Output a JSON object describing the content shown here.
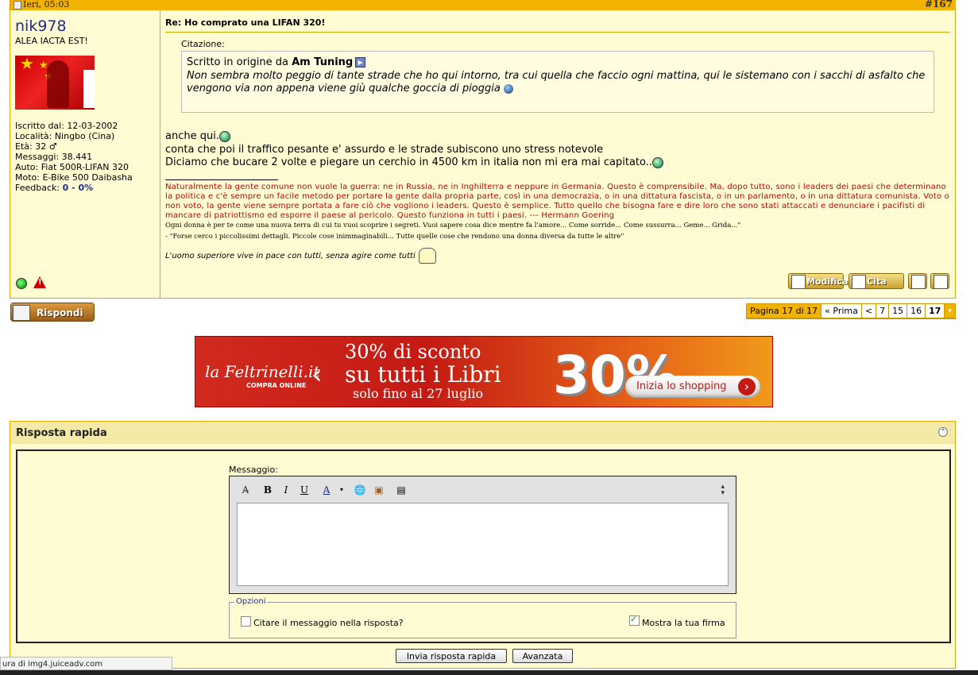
{
  "post": {
    "date": "Ieri, 05:03",
    "number": "#167",
    "title": "Re: Ho comprato una LIFAN 320!",
    "quote_label": "Citazione:",
    "quote_prefix": "Scritto in origine da",
    "quote_author": "Am Tuning",
    "quote_text": "Non sembra molto peggio di tante strade che ho qui intorno, tra cui quella che faccio ogni mattina, qui le sistemano con i sacchi di asfalto che vengono via non appena viene giù qualche goccia di pioggia",
    "body_line1": "anche qui.",
    "body_line2": "conta che poi il traffico pesante e' assurdo e le strade subiscono uno stress notevole",
    "body_line3": "Diciamo che bucare 2 volte e piegare un cerchio in 4500 km in italia non mi era mai capitato..",
    "sig1": "Naturalmente la gente comune non vuole la guerra: ne in Russia, ne in Inghilterra e neppure in Germania. Questo è comprensibile. Ma, dopo tutto, sono i leaders dei paesi che determinano la politica e c'è sempre un facile metodo per portare la gente dalla propria parte, così in una democrazia, o in una dittatura fascista, o in un parlamento, o in una dittatura comunista. Voto o non voto, la gente viene sempre portata a fare ciò che vogliono i leaders. Questo è semplice. Tutto quello che bisogna fare e dire loro che sono stati attaccati e denunciare i pacifisti di mancare di patriottismo ed esporre il paese al pericolo. Questo funziona in tutti i paesi. --- Hermann Goering",
    "sig2": "Ogni donna è per te come una nuova terra di cui tu vuoi scoprire i segreti. Vuoi sapere cosa dice mentre fa l'amore... Come sorride... Come sussurra... Geme... Grida...\"",
    "sig3": "- \"Forse cerco i piccolissimi dettagli. Piccole cose inimmaginabili... Tutte quelle cose che rendono una donna diversa da tutte le altre\"",
    "sig4": "L'uomo superiore vive in pace con tutti, senza agire come tutti",
    "btn_edit": "Modifica",
    "btn_quote": "Cita"
  },
  "user": {
    "name": "nik978",
    "title": "ALEA IACTA EST!",
    "joined": "Iscritto dal: 12-03-2002",
    "location": "Località: Ningbo (Cina)",
    "age": "Età: 32 ♂",
    "messages": "Messaggi: 38.441",
    "car": "Auto: Fiat 500R-LIFAN 320",
    "moto": "Moto: E-Bike 500 Daibasha",
    "feedback_label": "Feedback:",
    "feedback_value": "0 - 0%"
  },
  "reply_button": "Rispondi",
  "pager": {
    "label": "Pagina 17 di 17",
    "first": "« Prima",
    "prev": "<",
    "pages": [
      "7",
      "15",
      "16",
      "17"
    ],
    "dropdown": "▾"
  },
  "banner": {
    "logo": "la Feltrinelli.it",
    "sub": "COMPRA ONLINE",
    "line1": "30% di sconto",
    "line2": "su tutti i Libri",
    "line3": "solo fino al 27 luglio",
    "big": "30%",
    "cta": "Inizia lo shopping"
  },
  "quick_reply": {
    "title": "Risposta rapida",
    "message_label": "Messaggio:",
    "options_legend": "Opzioni",
    "opt_quote": "Citare il messaggio nella risposta?",
    "opt_signature": "Mostra la tua firma",
    "send": "Invia risposta rapida",
    "advanced": "Avanzata"
  },
  "status_bar": "ura di img4.juiceadv.com",
  "colors": {
    "header": "#f2b200",
    "post_bg": "#fffcd3",
    "username": "#1e2d8c",
    "signature_red": "#c00000"
  }
}
